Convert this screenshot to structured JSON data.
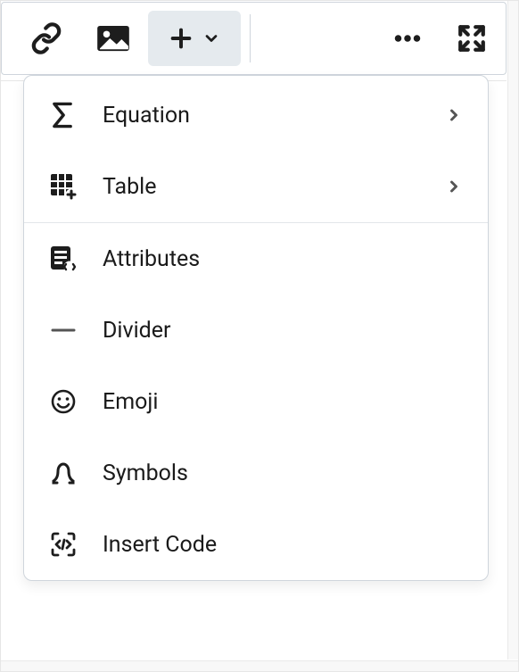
{
  "toolbar": {
    "link": {
      "icon": "link-icon"
    },
    "image": {
      "icon": "image-icon"
    },
    "insert": {
      "icon": "plus-icon",
      "chevron": "chevron-down-icon",
      "active": true
    },
    "more": {
      "icon": "more-icon"
    },
    "fullscreen": {
      "icon": "fullscreen-icon"
    }
  },
  "dropdown": {
    "items": [
      {
        "icon": "sigma-icon",
        "label": "Equation",
        "has_submenu": true
      },
      {
        "icon": "table-plus-icon",
        "label": "Table",
        "has_submenu": true
      },
      {
        "icon": "attributes-icon",
        "label": "Attributes",
        "has_submenu": false
      },
      {
        "icon": "divider-icon",
        "label": "Divider",
        "has_submenu": false
      },
      {
        "icon": "emoji-icon",
        "label": "Emoji",
        "has_submenu": false
      },
      {
        "icon": "omega-icon",
        "label": "Symbols",
        "has_submenu": false
      },
      {
        "icon": "code-brackets-icon",
        "label": "Insert Code",
        "has_submenu": false
      }
    ]
  }
}
